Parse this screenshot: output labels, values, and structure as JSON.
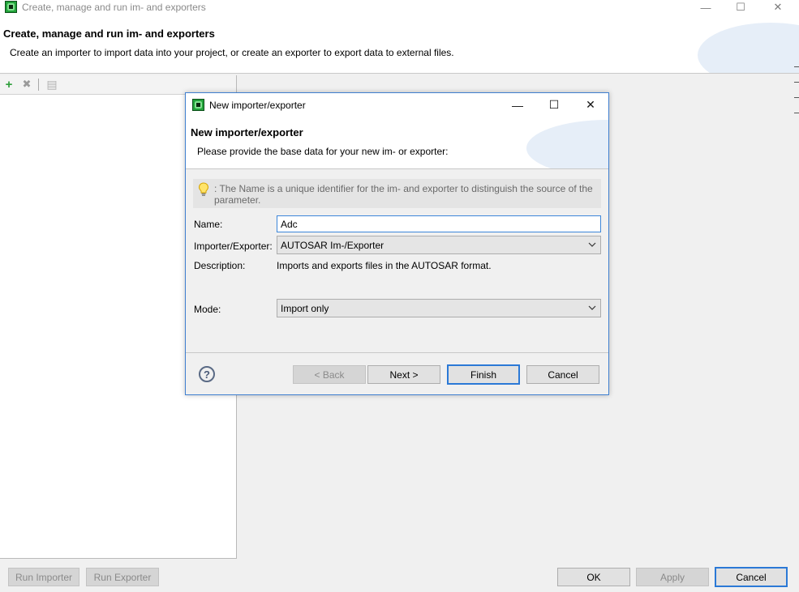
{
  "window": {
    "title": "Create, manage and run im- and exporters",
    "heading": "Create, manage and run im- and exporters",
    "description": "Create an importer to import data into your project, or create an exporter to export data to external files.",
    "controls": {
      "minimize": "—",
      "maximize": "☐",
      "close": "✕"
    }
  },
  "toolbar": {
    "add_icon": "+",
    "remove_icon": "✖",
    "copy_icon": "▤"
  },
  "bottom": {
    "run_importer": "Run Importer",
    "run_exporter": "Run Exporter",
    "ok": "OK",
    "apply": "Apply",
    "cancel": "Cancel"
  },
  "dialog": {
    "title": "New importer/exporter",
    "heading": "New importer/exporter",
    "description": "Please provide the base data for your new im- or exporter:",
    "controls": {
      "minimize": "—",
      "maximize": "☐",
      "close": "✕"
    },
    "info": ": The Name is a unique identifier for the im- and exporter to distinguish the source of the parameter.",
    "name_label": "Name:",
    "name_value": "Adc",
    "type_label": "Importer/Exporter:",
    "type_value": "AUTOSAR Im-/Exporter",
    "desc_label": "Description:",
    "desc_value": "Imports and exports files in the AUTOSAR format.",
    "mode_label": "Mode:",
    "mode_value": "Import only",
    "help": "?",
    "back": "< Back",
    "next": "Next >",
    "finish": "Finish",
    "cancel": "Cancel"
  },
  "colors": {
    "accent": "#2b79d6",
    "dialog_border": "#3f7fd0",
    "app_icon_green": "#22a33a"
  }
}
